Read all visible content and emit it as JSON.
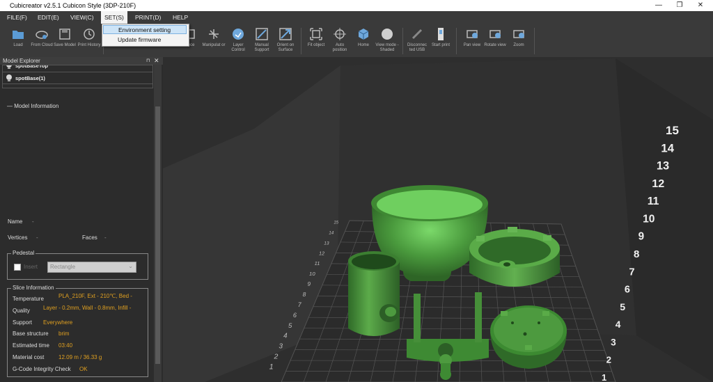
{
  "window": {
    "title": "Cubicreator v2.5.1   Cubicon Style (3DP-210F)",
    "minimize": "—",
    "maximize": "❐",
    "close": "✕"
  },
  "menu": [
    "FILE(F)",
    "EDIT(E)",
    "VIEW(C)",
    "SET(S)",
    "PRINT(D)",
    "HELP"
  ],
  "dropdown": [
    "Environment setting",
    "Update firmware"
  ],
  "toolbar": [
    {
      "label": "Load",
      "icon": "folder-icon"
    },
    {
      "label": "From Cloud",
      "icon": "cloud-icon"
    },
    {
      "label": "Save Model",
      "icon": "save-icon"
    },
    {
      "label": "Print History",
      "icon": "history-icon"
    },
    {
      "label": "ance",
      "icon": "placement-icon"
    },
    {
      "label": "Manipulat or",
      "icon": "manipulator-icon"
    },
    {
      "label": "Layer Control",
      "icon": "layer-icon"
    },
    {
      "label": "Manual Support",
      "icon": "support-icon"
    },
    {
      "label": "Orient on Surface",
      "icon": "orient-icon"
    },
    {
      "label": "Fit object",
      "icon": "fit-icon"
    },
    {
      "label": "Auto position",
      "icon": "auto-position-icon"
    },
    {
      "label": "Home",
      "icon": "home-cube-icon"
    },
    {
      "label": "View mode - Shaded",
      "icon": "sphere-icon"
    },
    {
      "label": "Disconnec ted USB",
      "icon": "usb-icon"
    },
    {
      "label": "Start print",
      "icon": "start-print-icon"
    },
    {
      "label": "Pan view",
      "icon": "pan-icon"
    },
    {
      "label": "Rotate view",
      "icon": "rotate-icon"
    },
    {
      "label": "Zoom",
      "icon": "zoom-icon"
    }
  ],
  "explorer": {
    "title": "Model Explorer",
    "pin": "⊓",
    "close": "✕",
    "items": [
      "spotBaseTop",
      "spotBase(1)"
    ],
    "model_info_title": "Model Information",
    "name_label": "Name",
    "name_value": "-",
    "vertices_label": "Vertices",
    "vertices_value": "-",
    "faces_label": "Faces",
    "faces_value": "-"
  },
  "pedestal": {
    "title": "Pedestal",
    "insert_label": "Insert",
    "shape": "Rectangle"
  },
  "slice": {
    "title": "Slice Information",
    "rows": [
      {
        "label": "Temperature",
        "value": "PLA_210F, Ext - 210℃, Bed -"
      },
      {
        "label": "Quality",
        "value": "Layer - 0.2mm, Wall - 0.8mm, Infill -"
      },
      {
        "label": "Support",
        "value": "Everywhere"
      },
      {
        "label": "Base structure",
        "value": "brim"
      },
      {
        "label": "Estimated time",
        "value": "03:40"
      },
      {
        "label": "Material cost",
        "value": "12.09 m / 36.33 g"
      },
      {
        "label": "G-Code Integrity Check",
        "value": "OK"
      }
    ]
  },
  "viewport": {
    "big_numbers": [
      "15",
      "14",
      "13",
      "12",
      "11",
      "10",
      "9",
      "8",
      "7",
      "6",
      "5",
      "4",
      "3",
      "2",
      "1"
    ],
    "grid_numbers": [
      "15",
      "14",
      "13",
      "12",
      "11",
      "10",
      "9",
      "8",
      "7",
      "6",
      "5",
      "4",
      "3",
      "2",
      "1"
    ]
  },
  "colors": {
    "model_green": "#3d7a33",
    "highlight": "#cde4f7",
    "accent_orange": "#e0a020"
  }
}
